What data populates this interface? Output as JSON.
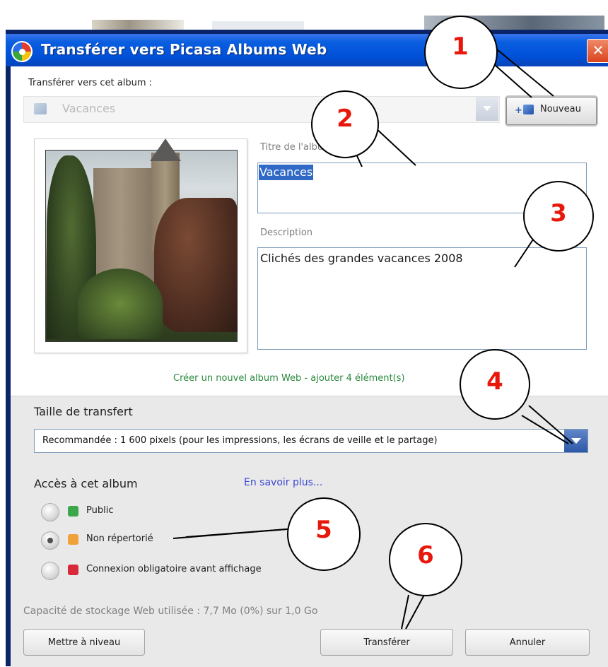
{
  "window": {
    "title": "Transférer vers Picasa Albums Web",
    "close_glyph": "✕",
    "logo_icon": "picasa-logo-icon"
  },
  "album_select": {
    "label": "Transférer vers cet album :",
    "value": "Vacances",
    "icon": "album-icon"
  },
  "new_button": {
    "label": "Nouveau",
    "icon_prefix": "+",
    "icon": "new-album-icon"
  },
  "album_title": {
    "label": "Titre de l'album",
    "value": "Vacances"
  },
  "description": {
    "label": "Description",
    "value": "Clichés des grandes vacances 2008"
  },
  "create_message": "Créer un nouvel album Web - ajouter 4 élément(s)",
  "transfer_size": {
    "label": "Taille de transfert",
    "value": "Recommandée : 1 600 pixels (pour les impressions, les écrans de veille et le partage)"
  },
  "access": {
    "label": "Accès à cet album",
    "learn_more": "En savoir plus...",
    "options": [
      {
        "label": "Public",
        "icon": "globe-icon",
        "selected": false,
        "color": "#3aa84a"
      },
      {
        "label": "Non répertorié",
        "icon": "unlisted-lock-icon",
        "selected": true,
        "color": "#f0a23a"
      },
      {
        "label": "Connexion obligatoire avant affichage",
        "icon": "lock-icon",
        "selected": false,
        "color": "#d8293a"
      }
    ]
  },
  "storage": "Capacité de stockage Web utilisée : 7,7 Mo (0%) sur 1,0 Go",
  "buttons": {
    "upgrade": "Mettre à niveau",
    "transfer": "Transférer",
    "cancel": "Annuler"
  },
  "callouts": [
    "1",
    "2",
    "3",
    "4",
    "5",
    "6"
  ],
  "colors": {
    "titlebar": "#0050d8",
    "selection": "#3169c6",
    "callout_number": "#e8170b",
    "link": "#3c4ad2",
    "create_message": "#2a8a3e"
  }
}
